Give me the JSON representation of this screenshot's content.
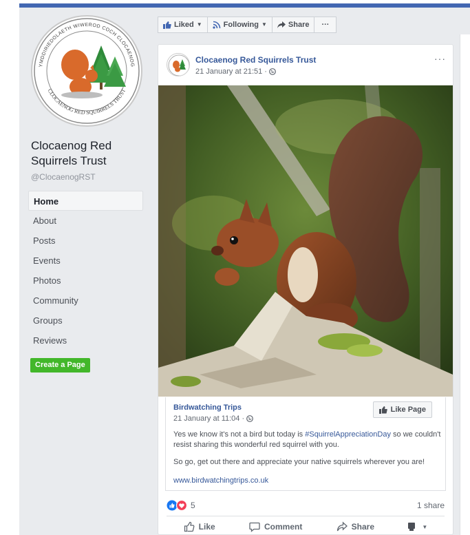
{
  "page": {
    "name": "Clocaenog Red Squirrels Trust",
    "handle": "@ClocaenogRST",
    "logo_text_top": "YMDDIRIEDOLAETH WIWEROD COCH CLOCAENOG",
    "logo_text_bottom": "CLOCAENOG RED SQUIRRELS TRUST"
  },
  "nav": {
    "items": [
      {
        "label": "Home"
      },
      {
        "label": "About"
      },
      {
        "label": "Posts"
      },
      {
        "label": "Events"
      },
      {
        "label": "Photos"
      },
      {
        "label": "Community"
      },
      {
        "label": "Groups"
      },
      {
        "label": "Reviews"
      }
    ],
    "create_page": "Create a Page"
  },
  "actionbar": {
    "liked": "Liked",
    "following": "Following",
    "share": "Share",
    "more": "···"
  },
  "post": {
    "author": "Clocaenog Red Squirrels Trust",
    "time": "21 January at 21:51 ·",
    "more": "···"
  },
  "shared": {
    "author": "Birdwatching Trips",
    "time": "21 January at 11:04 ·",
    "like_page": "Like Page",
    "text1_pre": "Yes we know it's not a bird but today is ",
    "text1_tag": "#SquirrelAppreciationDay",
    "text1_post": " so we couldn't resist sharing this wonderful red squirrel with you.",
    "text2": "So go, get out there and appreciate your native squirrels wherever you are!",
    "link": "www.birdwatchingtrips.co.uk"
  },
  "stats": {
    "reactions": "5",
    "shares": "1 share"
  },
  "actions": {
    "like": "Like",
    "comment": "Comment",
    "share": "Share"
  },
  "colors": {
    "fb_blue": "#4267b2",
    "link": "#365899",
    "green": "#42b72a"
  }
}
